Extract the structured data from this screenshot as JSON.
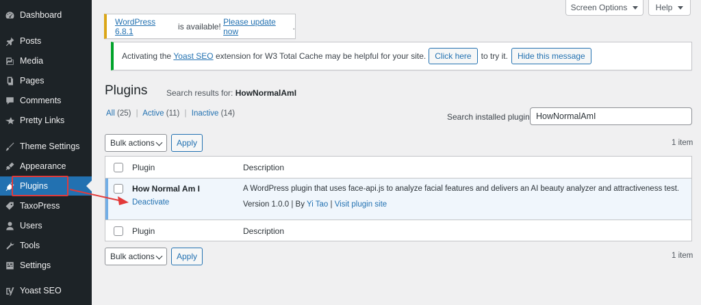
{
  "sidebar": {
    "items": [
      {
        "label": "Dashboard",
        "icon": "dashboard-icon"
      },
      {
        "label": "Posts",
        "icon": "pin-icon"
      },
      {
        "label": "Media",
        "icon": "media-icon"
      },
      {
        "label": "Pages",
        "icon": "pages-icon"
      },
      {
        "label": "Comments",
        "icon": "comment-icon"
      },
      {
        "label": "Pretty Links",
        "icon": "star-icon"
      },
      {
        "label": "Theme Settings",
        "icon": "brush-icon"
      },
      {
        "label": "Appearance",
        "icon": "appearance-icon"
      },
      {
        "label": "Plugins",
        "icon": "plugin-icon",
        "active": true
      },
      {
        "label": "TaxoPress",
        "icon": "tag-icon"
      },
      {
        "label": "Users",
        "icon": "users-icon"
      },
      {
        "label": "Tools",
        "icon": "wrench-icon"
      },
      {
        "label": "Settings",
        "icon": "settings-icon"
      },
      {
        "label": "Yoast SEO",
        "icon": "yoast-icon"
      }
    ]
  },
  "top": {
    "screen_options": "Screen Options",
    "help": "Help"
  },
  "update_notice": {
    "link1": "WordPress 6.8.1",
    "text": " is available! ",
    "link2": "Please update now",
    "end": "."
  },
  "yoast_notice": {
    "pre": "Activating the ",
    "link": "Yoast SEO",
    "post": " extension for W3 Total Cache may be helpful for your site.",
    "click_here": "Click here",
    "try": "to try it.",
    "hide": "Hide this message"
  },
  "page": {
    "title": "Plugins",
    "subtitle_prefix": "Search results for: ",
    "search_term": "HowNormalAmI"
  },
  "filters": {
    "all": "All",
    "all_count": "(25)",
    "active": "Active",
    "active_count": "(11)",
    "inactive": "Inactive",
    "inactive_count": "(14)",
    "separator": "|"
  },
  "search": {
    "label": "Search installed plugins",
    "value": "HowNormalAmI"
  },
  "bulk": {
    "label": "Bulk actions",
    "apply": "Apply",
    "count": "1 item"
  },
  "table": {
    "col_plugin": "Plugin",
    "col_description": "Description",
    "rows": [
      {
        "name": "How Normal Am I",
        "action": "Deactivate",
        "description": "A WordPress plugin that uses face-api.js to analyze facial features and delivers an AI beauty analyzer and attractiveness test.",
        "version": "Version 1.0.0",
        "by": "By",
        "author": "Yi Tao",
        "visit": "Visit plugin site",
        "sep": "|"
      }
    ]
  },
  "colors": {
    "sidebar_bg": "#1d2327",
    "active_bg": "#2271b1",
    "link": "#2271b1",
    "update_border": "#dba617",
    "success_border": "#00a32a",
    "active_row_border": "#72aee6",
    "annotation_red": "#e23a3a"
  }
}
